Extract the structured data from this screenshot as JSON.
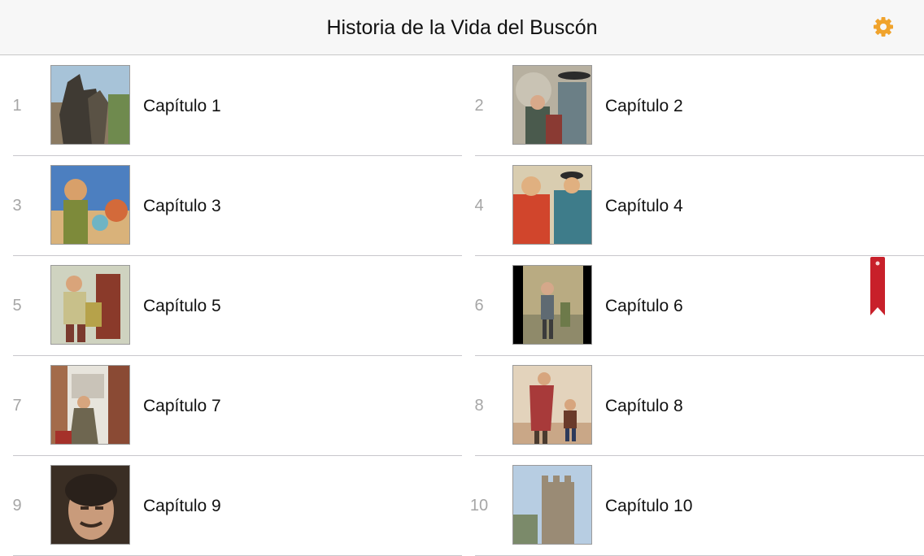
{
  "navbar": {
    "title": "Historia de la Vida del Buscón",
    "settings_icon": "gear-icon",
    "accent_color": "#f0a32c"
  },
  "chapters": [
    {
      "number": "1",
      "label": "Capítulo 1"
    },
    {
      "number": "2",
      "label": "Capítulo 2"
    },
    {
      "number": "3",
      "label": "Capítulo 3"
    },
    {
      "number": "4",
      "label": "Capítulo 4"
    },
    {
      "number": "5",
      "label": "Capítulo 5"
    },
    {
      "number": "6",
      "label": "Capítulo 6"
    },
    {
      "number": "7",
      "label": "Capítulo 7"
    },
    {
      "number": "8",
      "label": "Capítulo 8"
    },
    {
      "number": "9",
      "label": "Capítulo 9"
    },
    {
      "number": "10",
      "label": "Capítulo 10"
    }
  ],
  "bookmark": {
    "icon": "bookmark-icon",
    "color": "#c8202a",
    "chapter": "6"
  }
}
